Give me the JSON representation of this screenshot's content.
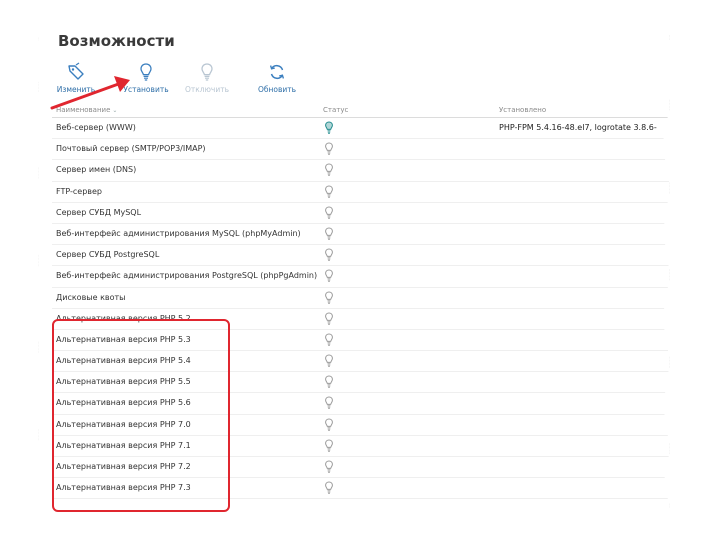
{
  "page": {
    "title": "Возможности"
  },
  "toolbar": {
    "buttons": [
      {
        "label": "Изменить",
        "icon": "edit-tag-icon",
        "state": "active"
      },
      {
        "label": "Установить",
        "icon": "lightbulb-icon",
        "state": "active"
      },
      {
        "label": "Отключить",
        "icon": "lightbulb-off-icon",
        "state": "disabled"
      },
      {
        "label": "Обновить",
        "icon": "refresh-icon",
        "state": "active"
      }
    ]
  },
  "table": {
    "columns": {
      "name": "Наименование",
      "status": "Статус",
      "installed": "Установлено"
    },
    "rows": [
      {
        "name": "Веб-сервер (WWW)",
        "status": "installed",
        "installed": "PHP-FPM 5.4.16-48.el7, logrotate 3.8.6-"
      },
      {
        "name": "Почтовый сервер (SMTP/POP3/IMAP)",
        "status": "not-installed",
        "installed": ""
      },
      {
        "name": "Сервер имен (DNS)",
        "status": "not-installed",
        "installed": ""
      },
      {
        "name": "FTP-сервер",
        "status": "not-installed",
        "installed": ""
      },
      {
        "name": "Сервер СУБД MySQL",
        "status": "not-installed",
        "installed": ""
      },
      {
        "name": "Веб-интерфейс администрирования MySQL (phpMyAdmin)",
        "status": "not-installed",
        "installed": "",
        "selected": true
      },
      {
        "name": "Сервер СУБД PostgreSQL",
        "status": "not-installed",
        "installed": ""
      },
      {
        "name": "Веб-интерфейс администрирования PostgreSQL (phpPgAdmin)",
        "status": "not-installed",
        "installed": ""
      },
      {
        "name": "Дисковые квоты",
        "status": "not-installed",
        "installed": ""
      },
      {
        "name": "Альтернативная версия PHP 5.2",
        "status": "not-installed",
        "installed": ""
      },
      {
        "name": "Альтернативная версия PHP 5.3",
        "status": "not-installed",
        "installed": ""
      },
      {
        "name": "Альтернативная версия PHP 5.4",
        "status": "not-installed",
        "installed": ""
      },
      {
        "name": "Альтернативная версия PHP 5.5",
        "status": "not-installed",
        "installed": ""
      },
      {
        "name": "Альтернативная версия PHP 5.6",
        "status": "not-installed",
        "installed": ""
      },
      {
        "name": "Альтернативная версия PHP 7.0",
        "status": "not-installed",
        "installed": ""
      },
      {
        "name": "Альтернативная версия PHP 7.1",
        "status": "not-installed",
        "installed": ""
      },
      {
        "name": "Альтернативная версия PHP 7.2",
        "status": "not-installed",
        "installed": ""
      },
      {
        "name": "Альтернативная версия PHP 7.3",
        "status": "not-installed",
        "installed": ""
      }
    ]
  },
  "colors": {
    "accent": "#2f6fa8",
    "icon_active": "#3b7fbf",
    "status_installed": "#1f8a8c",
    "status_idle": "#9a9a9a",
    "annotation": "#e0262f",
    "selection": "#4f8fc8"
  }
}
